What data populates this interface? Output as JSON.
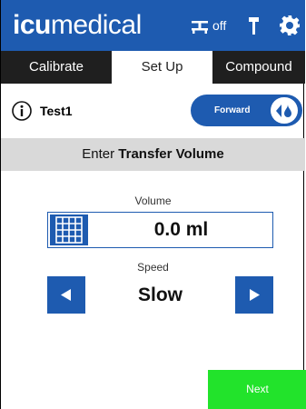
{
  "header": {
    "logo_bold": "icu",
    "logo_light": "medical",
    "pump_status": "off",
    "icons": [
      "pump-indicator-icon",
      "flag-icon",
      "gear-icon"
    ]
  },
  "tabs": [
    {
      "label": "Calibrate",
      "active": false
    },
    {
      "label": "Set Up",
      "active": true
    },
    {
      "label": "Compound",
      "active": false
    }
  ],
  "info_row": {
    "name": "Test1",
    "direction_label": "Forward"
  },
  "section": {
    "prefix": "Enter ",
    "bold": "Transfer Volume"
  },
  "volume": {
    "label": "Volume",
    "value": "0.0 ml"
  },
  "speed": {
    "label": "Speed",
    "value": "Slow"
  },
  "footer": {
    "next_label": "Next"
  },
  "colors": {
    "brand_blue": "#1e5bb0",
    "tab_dark": "#1f1f1f",
    "section_gray": "#d9d9d9",
    "next_green": "#22e32b"
  }
}
